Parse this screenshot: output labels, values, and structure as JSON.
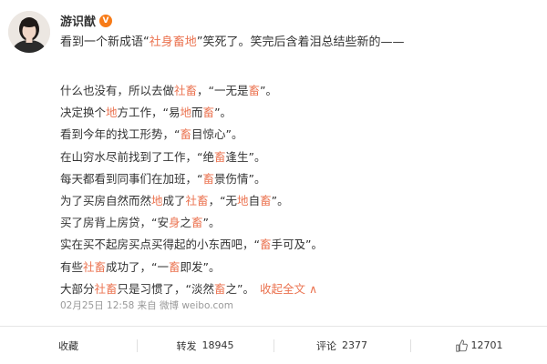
{
  "author": {
    "name": "游识猷"
  },
  "intro": {
    "before": "看到一个新成语“",
    "highlight": "社身畜地",
    "after": "”笑死了。笑完后含着泪总结些新的——"
  },
  "lines": [
    {
      "segments": [
        {
          "text": "什么也没有，所以去做",
          "hl": false
        },
        {
          "text": "社畜",
          "hl": true
        },
        {
          "text": "，“一无是",
          "hl": false
        },
        {
          "text": "畜",
          "hl": true
        },
        {
          "text": "”。",
          "hl": false
        }
      ]
    },
    {
      "segments": [
        {
          "text": "决定换个",
          "hl": false
        },
        {
          "text": "地",
          "hl": true
        },
        {
          "text": "方工作，“易",
          "hl": false
        },
        {
          "text": "地",
          "hl": true
        },
        {
          "text": "而",
          "hl": false
        },
        {
          "text": "畜",
          "hl": true
        },
        {
          "text": "”。",
          "hl": false
        }
      ]
    },
    {
      "segments": [
        {
          "text": "看到今年的找工形势，“",
          "hl": false
        },
        {
          "text": "畜",
          "hl": true
        },
        {
          "text": "目惊心”。",
          "hl": false
        }
      ]
    },
    {
      "segments": [
        {
          "text": "在山穷水尽前找到了工作，“绝",
          "hl": false
        },
        {
          "text": "畜",
          "hl": true
        },
        {
          "text": "逢生”。",
          "hl": false
        }
      ]
    },
    {
      "segments": [
        {
          "text": "每天都看到同事们在加班，“",
          "hl": false
        },
        {
          "text": "畜",
          "hl": true
        },
        {
          "text": "景伤情”。",
          "hl": false
        }
      ]
    },
    {
      "segments": [
        {
          "text": "为了买房自然而然",
          "hl": false
        },
        {
          "text": "地",
          "hl": true
        },
        {
          "text": "成了",
          "hl": false
        },
        {
          "text": "社畜",
          "hl": true
        },
        {
          "text": "，“无",
          "hl": false
        },
        {
          "text": "地",
          "hl": true
        },
        {
          "text": "自",
          "hl": false
        },
        {
          "text": "畜",
          "hl": true
        },
        {
          "text": "”。",
          "hl": false
        }
      ]
    },
    {
      "segments": [
        {
          "text": "买了房背上房贷，“安",
          "hl": false
        },
        {
          "text": "身",
          "hl": true
        },
        {
          "text": "之",
          "hl": false
        },
        {
          "text": "畜",
          "hl": true
        },
        {
          "text": "”。",
          "hl": false
        }
      ]
    },
    {
      "segments": [
        {
          "text": "实在买不起房买点买得起的小东西吧，“",
          "hl": false
        },
        {
          "text": "畜",
          "hl": true
        },
        {
          "text": "手可及”。",
          "hl": false
        }
      ]
    },
    {
      "segments": [
        {
          "text": "有些",
          "hl": false
        },
        {
          "text": "社畜",
          "hl": true
        },
        {
          "text": "成功了，“一",
          "hl": false
        },
        {
          "text": "畜",
          "hl": true
        },
        {
          "text": "即发”。",
          "hl": false
        }
      ]
    },
    {
      "segments": [
        {
          "text": "大部分",
          "hl": false
        },
        {
          "text": "社畜",
          "hl": true
        },
        {
          "text": "只是习惯了，“淡然",
          "hl": false
        },
        {
          "text": "畜",
          "hl": true
        },
        {
          "text": "之”。",
          "hl": false
        }
      ]
    }
  ],
  "collapse_label": "收起全文 ∧",
  "meta": {
    "text": "02月25日 12:58 来自 微博 weibo.com"
  },
  "actions": {
    "favorite": {
      "label": "收藏"
    },
    "repost": {
      "label": "转发",
      "count": "18945"
    },
    "comment": {
      "label": "评论",
      "count": "2377"
    },
    "like": {
      "count": "12701"
    }
  },
  "colors": {
    "highlight": "#eb7350",
    "text": "#333333",
    "meta": "#999999",
    "verified": "#f77b18"
  },
  "icons": {
    "verified": "verified-v-icon",
    "like": "thumbs-up-icon"
  }
}
